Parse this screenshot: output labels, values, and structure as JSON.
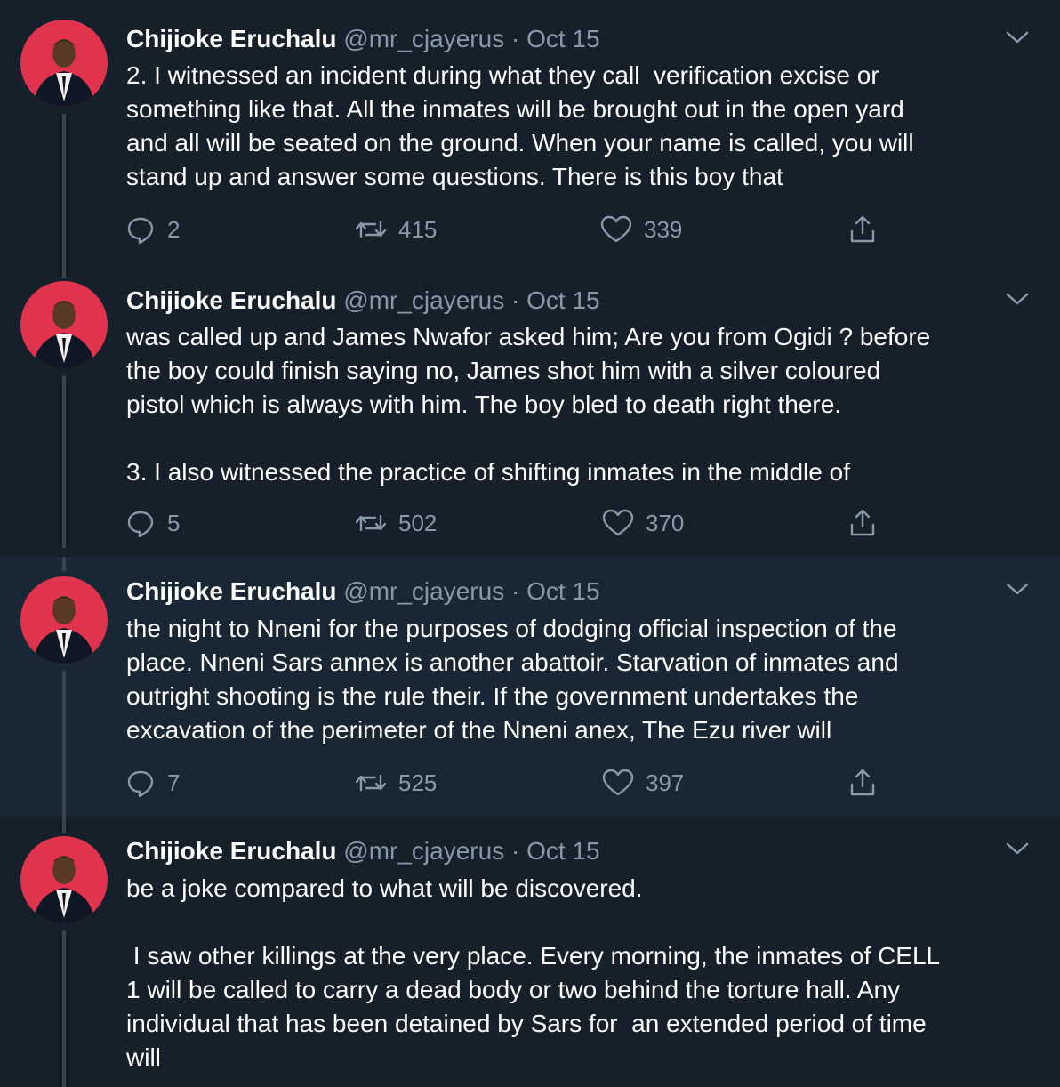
{
  "colors": {
    "background": "#15202b",
    "highlight_background": "#192734",
    "muted_text": "#8899a6",
    "thread_line": "#38444d",
    "avatar_background": "#e0334d"
  },
  "icons": {
    "reply": "reply-icon",
    "retweet": "retweet-icon",
    "like": "heart-icon",
    "share": "share-icon",
    "more": "chevron-down-icon"
  },
  "tweets": [
    {
      "name": "Chijioke Eruchalu",
      "handle": "@mr_cjayerus",
      "separator": "·",
      "date": "Oct 15",
      "text": "2. I witnessed an incident during what they call  verification excise or\nsomething like that. All the inmates will be brought out in the open yard\nand all will be seated on the ground. When your name is called, you will\nstand up and answer some questions. There is this boy that",
      "replies": "2",
      "retweets": "415",
      "likes": "339"
    },
    {
      "name": "Chijioke Eruchalu",
      "handle": "@mr_cjayerus",
      "separator": "·",
      "date": "Oct 15",
      "text": "was called up and James Nwafor asked him; Are you from Ogidi ? before\nthe boy could finish saying no, James shot him with a silver coloured\npistol which is always with him. The boy bled to death right there.\n\n3. I also witnessed the practice of shifting inmates in the middle of",
      "replies": "5",
      "retweets": "502",
      "likes": "370"
    },
    {
      "name": "Chijioke Eruchalu",
      "handle": "@mr_cjayerus",
      "separator": "·",
      "date": "Oct 15",
      "text": "the night to Nneni for the purposes of dodging official inspection of the\nplace. Nneni Sars annex is another abattoir. Starvation of inmates and\noutright shooting is the rule their. If the government undertakes the\nexcavation of the perimeter of the Nneni anex, The Ezu river will",
      "replies": "7",
      "retweets": "525",
      "likes": "397"
    },
    {
      "name": "Chijioke Eruchalu",
      "handle": "@mr_cjayerus",
      "separator": "·",
      "date": "Oct 15",
      "text": "be a joke compared to what will be discovered.\n\n I saw other killings at the very place. Every morning, the inmates of CELL\n1 will be called to carry a dead body or two behind the torture hall. Any\nindividual that has been detained by Sars for  an extended period of time\nwill"
    }
  ]
}
